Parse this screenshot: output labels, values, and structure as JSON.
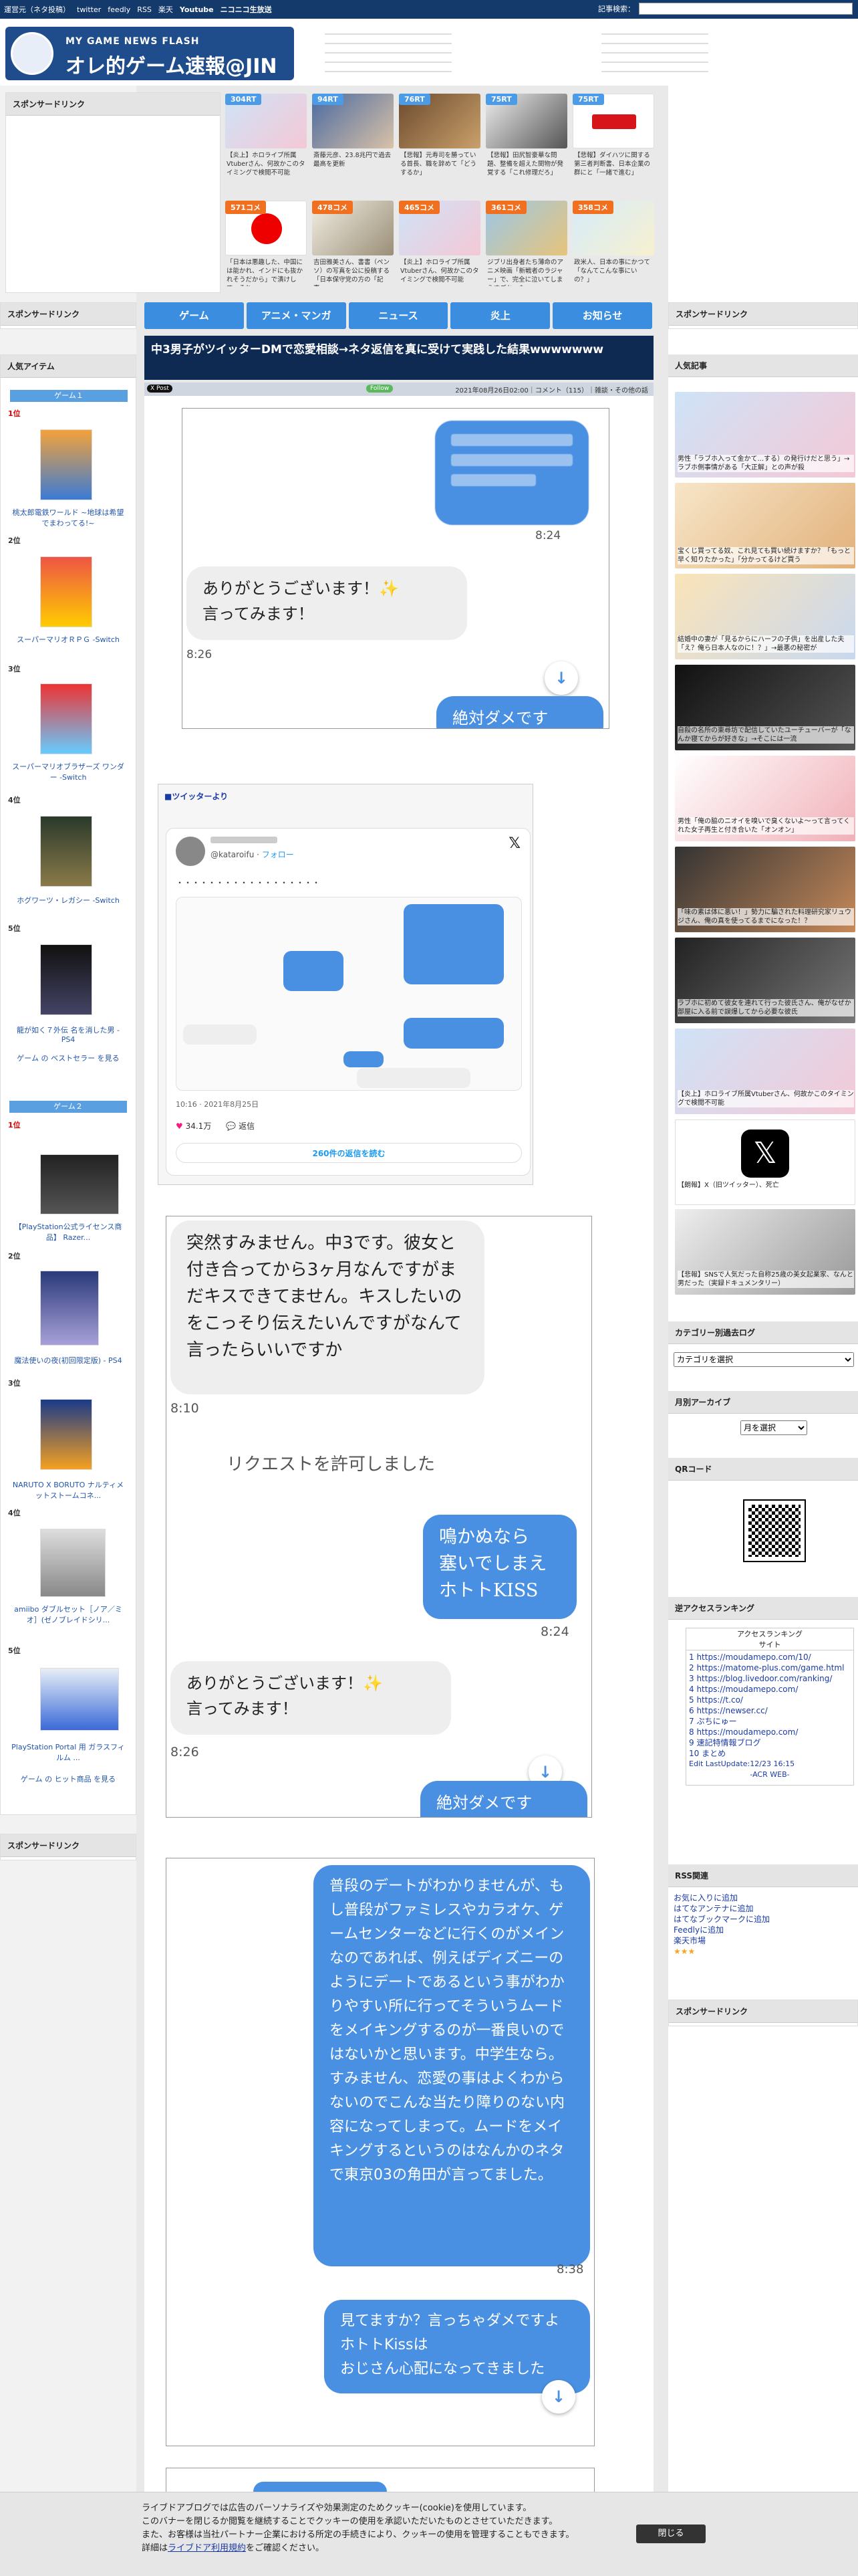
{
  "topbar": {
    "links": [
      "運営元（ネタ投稿）",
      "twitter",
      "feedly",
      "RSS",
      "楽天",
      "Youtube",
      "ニコニコ生放送"
    ],
    "search_label": "記事検索："
  },
  "logo": {
    "tag": "MY GAME NEWS FLASH",
    "name": "オレ的ゲーム速報@JIN"
  },
  "sponsored": "スポンサードリンク",
  "thumbs": [
    {
      "badge": "304RT",
      "cap": "【炎上】ホロライブ所属Vtuberさん、何故かこのタイミングで検閲不可能"
    },
    {
      "badge": "94RT",
      "cap": "斎藤元彦、23.8兆円で過去最高を更新"
    },
    {
      "badge": "76RT",
      "cap": "【悲報】元寿司を勝っている首長、職を辞めて「どうするか」"
    },
    {
      "badge": "75RT",
      "cap": "【悲報】田尻智豪華な問題、整備を超えた関物が発覚する「これ修理だろ」"
    },
    {
      "badge": "75RT",
      "cap": "【悲報】ダイハツに関する第三者判断書、日本企業の群にと「一緒で進む」"
    },
    {
      "badge": "571コメ",
      "cap": "「日本は悪趣した、中国には能かれ、インドにも抜かれそうだから」で漬けして、それ"
    },
    {
      "badge": "478コメ",
      "cap": "吉田雅美さん、書書（ペンソ）の写真を公に投稿する「日本保守党の方の「記事」"
    },
    {
      "badge": "465コメ",
      "cap": "【炎上】ホロライブ所属Vtuberさん、何故かこのタイミングで検閲不可能"
    },
    {
      "badge": "361コメ",
      "cap": "ジブリ出身者たち薄命のアニメ映画「新戦者のラジャー」で、完全に泣いてしまうすごかった"
    },
    {
      "badge": "358コメ",
      "cap": "政米人、日本の事にかつて「なんてこんな事にいの？」"
    }
  ],
  "nav": [
    "ゲーム",
    "アニメ・マンガ",
    "ニュース",
    "炎上",
    "お知らせ"
  ],
  "article": {
    "title": "中3男子がツイッターDMで恋愛相談→ネタ返信を真に受けて実践した結果wwwwwww",
    "date": "2021年08月26日02:00",
    "comments": "コメント（115）",
    "category": "雑談・その他の話",
    "x_label": "X Post",
    "follow": "Follow",
    "tw_source": "■ツイッターより"
  },
  "chat1": {
    "time1": "8:24",
    "msg": "ありがとうございます！✨\n言ってみます！",
    "time2": "8:26",
    "cut": "絶対ダメです"
  },
  "tweet": {
    "handle": "@kataroifu",
    "follow": "フォロー",
    "text": "・・・・・・・・・・・・・・・・・・",
    "time": "10:16 · 2021年8月25日",
    "likes": "34.1万",
    "replies": "返信",
    "reply_link": "260件の返信を読む"
  },
  "chat2": {
    "msg1": "突然すみません。中3です。彼女と付き合ってから3ヶ月なんですがまだキスできてません。キスしたいのをこっそり伝えたいんですがなんて言ったらいいですか",
    "t1": "8:10",
    "req": "リクエストを許可しました",
    "reply": "鳴かぬなら\n塞いでしまえ\nホトトKISS",
    "t2": "8:24",
    "thanks": "ありがとうございます！✨\n言ってみます！",
    "t3": "8:26",
    "cut": "絶対ダメです"
  },
  "chat3": {
    "msg": "普段のデートがわかりませんが、もし普段がファミレスやカラオケ、ゲームセンターなどに行くのがメインなのであれば、例えばディズニーのようにデートであるという事がわかりやすい所に行ってそういうムードをメイキングするのが一番良いのではないかと思います。中学生なら。\nすみません、恋愛の事はよくわからないのでこんな当たり障りのない内容になってしまって。ムードをメイキングするというのはなんかのネタで東京03の角田が言ってました。",
    "t1": "8:38",
    "msg2": "見てますか？言っちゃダメですよホトトKissは\nおじさん心配になってきました"
  },
  "left": {
    "popular": "人気アイテム",
    "game1": "ゲーム１",
    "game2": "ゲーム２",
    "items1": [
      {
        "rank": "1位",
        "name": "桃太郎電鉄ワールド ~地球は希望でまわってる!~"
      },
      {
        "rank": "2位",
        "name": "スーパーマリオＲＰＧ -Switch"
      },
      {
        "rank": "3位",
        "name": "スーパーマリオブラザーズ ワンダー -Switch"
      },
      {
        "rank": "4位",
        "name": "ホグワーツ・レガシー -Switch"
      },
      {
        "rank": "5位",
        "name": "龍が如く７外伝 名を消した男 - PS4"
      }
    ],
    "more1": "ゲーム の ベストセラー を見る",
    "items2": [
      {
        "rank": "1位",
        "name": "【PlayStation公式ライセンス商品】 Razer..."
      },
      {
        "rank": "2位",
        "name": "魔法使いの夜(初回限定版) - PS4"
      },
      {
        "rank": "3位",
        "name": "NARUTO X BORUTO ナルティメットストームコネ..."
      },
      {
        "rank": "4位",
        "name": "amiibo ダブルセット［ノア／ミオ］(ゼノブレイドシリ..."
      },
      {
        "rank": "5位",
        "name": "PlayStation Portal 用 ガラスフィルム ..."
      }
    ],
    "more2": "ゲーム の ヒット商品 を見る"
  },
  "right": {
    "popular": "人気記事",
    "articles": [
      "男性「ラブホ入って金かて...する）の発行けだと思う」→ラブホ側事情がある「大正解」との声が殺",
      "宝くじ買ってる奴、これ見ても買い続けますか？「もっと早く知りたかった」「分かってるけど買う",
      "結婚中の妻が「見るからにハーフの子供」を出産した夫「え？俺ら日本人なのに！？」→最悪の秘密が",
      "自殺の名所の東尋坊で配信していたユーチューバーが「なんか寝てからが好きな」→そこには一流",
      "男性「俺の脇のニオイを嗅いで臭くないよ〜って言ってくれた女子再生と付き合いた「オンオン」",
      "「味の素は体に悪い！」勢力に騙された料理研究家リュウジさん、俺の真を使ってるまでになった！？",
      "ラブホに初めて彼女を連れて行った彼氏さん、俺がなぜか部屋に入る前で誤爆してから必要な彼氏",
      "【炎上】ホロライブ所属Vtuberさん、何故かこのタイミングで検閲不可能",
      "【朗報】X（旧ツイッター）、死亡",
      "【悲報】SNSで人気だった自称25歳の美女起業家、なんと男だった（実録ドキュメンタリー）"
    ],
    "category": "カテゴリー別過去ログ",
    "category_sel": "カテゴリを選択",
    "monthly": "月別アーカイブ",
    "monthly_sel": "月を選択",
    "qr": "QRコード",
    "access": "逆アクセスランキング",
    "rank_title": "アクセスランキング",
    "rank_col": "サイト",
    "ranks": [
      "https://moudamepo.com/10/",
      "https://matome-plus.com/game.html",
      "https://blog.livedoor.com/ranking/",
      "https://moudamepo.com/",
      "https://t.co/",
      "https://newser.cc/",
      "ぷちにゅー",
      "https://moudamepo.com/",
      "速記特情報ブログ",
      "まとめ"
    ],
    "rank_footer": "Edit LastUpdate:12/23 16:15",
    "rank_foot2": "-ACR WEB-",
    "rss": "RSS関連",
    "rss_links": [
      "お気に入りに追加",
      "はてなアンテナに追加",
      "はてなブックマークに追加",
      "Feedlyに追加",
      "楽天市場"
    ]
  },
  "cookie": {
    "line1": "ライブドアブログでは広告のパーソナライズや効果測定のためクッキー(cookie)を使用しています。",
    "line2": "このバナーを閉じるか閲覧を継続することでクッキーの使用を承認いただいたものとさせていただきます。",
    "line3": "また、お客様は当社パートナー企業における所定の手続きにより、クッキーの使用を管理することもできます。",
    "line4a": "詳細は",
    "link": "ライブドア利用規約",
    "line4b": "をご確認ください。",
    "close": "閉じる"
  }
}
